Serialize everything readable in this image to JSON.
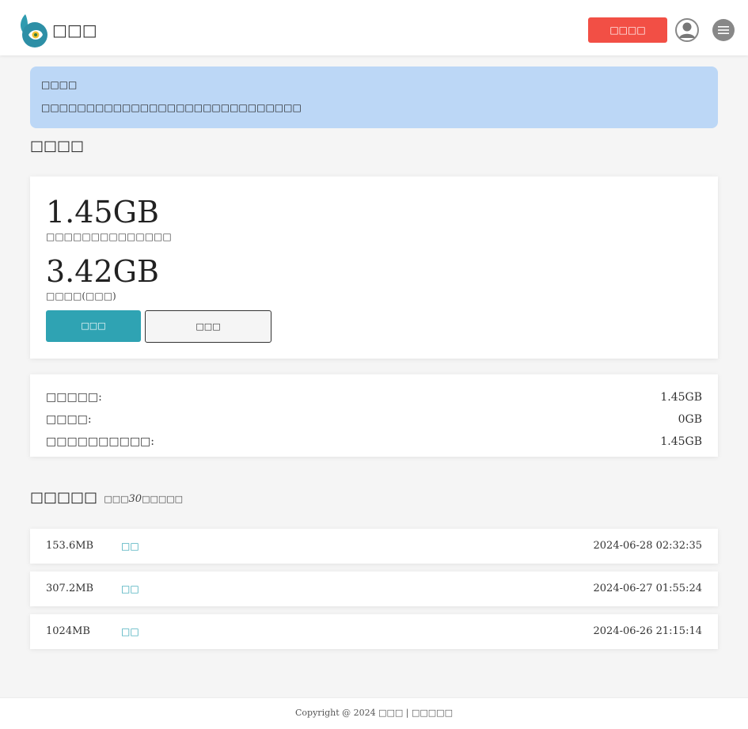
{
  "header": {
    "brand_name": "□□□",
    "recharge_button": "□□□□",
    "avatar_icon": "user-avatar-icon",
    "menu_icon": "hamburger-menu-icon"
  },
  "notice": {
    "title": "□□□□",
    "text": "□□□□□□□□□□□□□□□□□□□□□□□□□□□□□"
  },
  "data_section": {
    "title": "□□□□",
    "available_value": "1.45GB",
    "available_label": "□□□□□□□□□□□□□□",
    "total_value": "3.42GB",
    "total_label": "□□□□(□□□)",
    "primary_button": "□□□",
    "secondary_button": "□□□"
  },
  "summary": [
    {
      "label": "□□□□□:",
      "value": "1.45GB"
    },
    {
      "label": "□□□□:",
      "value": "0GB"
    },
    {
      "label": "□□□□□□□□□□:",
      "value": "1.45GB"
    }
  ],
  "usage": {
    "title": "□□□□□",
    "subtitle_pre": "□□□",
    "subtitle_num": "30",
    "subtitle_post": "□□□□□",
    "records": [
      {
        "size": "153.6MB",
        "type": "□□",
        "time": "2024-06-28 02:32:35"
      },
      {
        "size": "307.2MB",
        "type": "□□",
        "time": "2024-06-27 01:55:24"
      },
      {
        "size": "1024MB",
        "type": "□□",
        "time": "2024-06-26 21:15:14"
      }
    ]
  },
  "footer": {
    "copyright": "Copyright @ 2024 □□□ | □□□□□"
  },
  "colors": {
    "accent": "#2fa3b3",
    "recharge": "#f24f45",
    "notice_bg": "#bcd7f6"
  }
}
